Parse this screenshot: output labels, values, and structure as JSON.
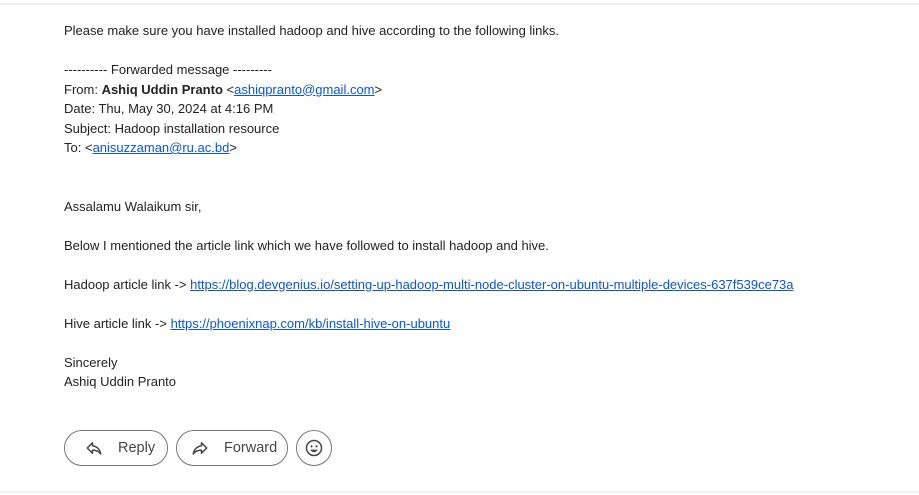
{
  "message": {
    "intro": "Please make sure you have installed hadoop and hive according to the following links.",
    "forwarded_header": "---------- Forwarded message ---------",
    "from_label": "From: ",
    "from_name": "Ashiq Uddin Pranto",
    "from_email": "ashiqpranto@gmail.com",
    "date_line": "Date: Thu, May 30, 2024 at 4:16 PM",
    "subject_line": "Subject: Hadoop installation resource",
    "to_label": "To: ",
    "to_email": "anisuzzaman@ru.ac.bd",
    "greeting": "Assalamu Walaikum sir,",
    "body_line": "Below I mentioned the article link which we have followed to install hadoop and hive.",
    "hadoop_label": "Hadoop article link -> ",
    "hadoop_url": "https://blog.devgenius.io/setting-up-hadoop-multi-node-cluster-on-ubuntu-multiple-devices-637f539ce73a",
    "hive_label": "Hive article link -> ",
    "hive_url": "https://phoenixnap.com/kb/install-hive-on-ubuntu",
    "closing": "Sincerely",
    "signature": "Ashiq Uddin Pranto"
  },
  "actions": {
    "reply_label": "Reply",
    "forward_label": "Forward",
    "reply_icon": "reply-arrow-icon",
    "forward_icon": "forward-arrow-icon",
    "emoji_icon": "emoji-reaction-icon"
  },
  "colors": {
    "link": "#1155cc",
    "text": "#222222",
    "button_border": "#747775"
  }
}
